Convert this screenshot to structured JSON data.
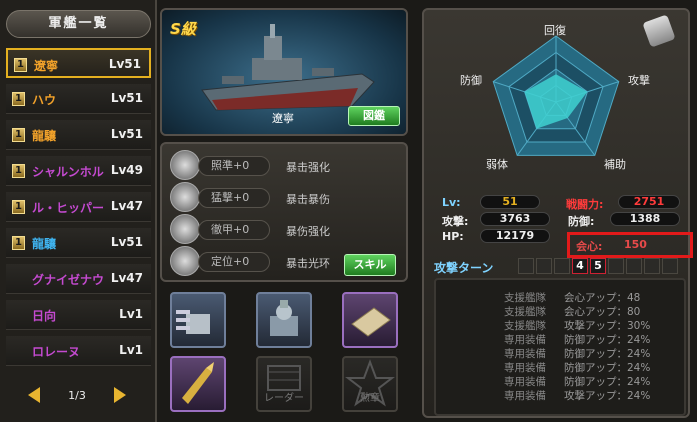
{
  "sidebar": {
    "title": "軍艦一覧",
    "ships": [
      {
        "name": "遼寧",
        "level": "Lv51",
        "badge": "1",
        "color": "#f2a22a",
        "selected": true
      },
      {
        "name": "ハウ",
        "level": "Lv51",
        "badge": "1",
        "color": "#f2a22a",
        "selected": false
      },
      {
        "name": "龍驤",
        "level": "Lv51",
        "badge": "1",
        "color": "#f2a22a",
        "selected": false
      },
      {
        "name": "シャルンホル",
        "level": "Lv49",
        "badge": "1",
        "color": "#c44ad0",
        "selected": false
      },
      {
        "name": "ル・ヒッパー",
        "level": "Lv47",
        "badge": "1",
        "color": "#c44ad0",
        "selected": false
      },
      {
        "name": "龍驤",
        "level": "Lv51",
        "badge": "1",
        "color": "#3fb4f0",
        "selected": false
      },
      {
        "name": "グナイゼナウ",
        "level": "Lv47",
        "badge": "",
        "color": "#c44ad0",
        "selected": false
      },
      {
        "name": "日向",
        "level": "Lv1",
        "badge": "",
        "color": "#c44ad0",
        "selected": false
      },
      {
        "name": "ロレーヌ",
        "level": "Lv1",
        "badge": "",
        "color": "#c44ad0",
        "selected": false
      }
    ],
    "page": "1/3"
  },
  "ship": {
    "grade": "S級",
    "name": "遼寧",
    "figure_button": "図鑑"
  },
  "skills": [
    {
      "name": "照準+0",
      "desc": "暴击强化"
    },
    {
      "name": "猛撃+0",
      "desc": "暴击暴伤"
    },
    {
      "name": "徹甲+0",
      "desc": "暴伤强化"
    },
    {
      "name": "定位+0",
      "desc": "暴击光环"
    }
  ],
  "skill_button": "スキル",
  "equipment": {
    "slot_radar": "レーダー",
    "slot_medal": "勲章"
  },
  "radar": {
    "axes": [
      "回復",
      "攻撃",
      "補助",
      "弱体",
      "防御"
    ],
    "values": [
      0.42,
      0.5,
      0.3,
      0.5,
      0.5
    ]
  },
  "stats": {
    "lv_label": "Lv:",
    "lv": "51",
    "power_label": "戦闘力:",
    "power": "2751",
    "atk_label": "攻撃:",
    "atk": "3763",
    "def_label": "防御:",
    "def": "1388",
    "hp_label": "HP:",
    "hp": "12179",
    "crit_label": "会心:",
    "crit": "150"
  },
  "turn": {
    "label": "攻撃ターン",
    "active": [
      "4",
      "5"
    ]
  },
  "bonuses": [
    {
      "source": "支援艦隊",
      "effect": "会心アップ：48"
    },
    {
      "source": "支援艦隊",
      "effect": "会心アップ：80"
    },
    {
      "source": "支援艦隊",
      "effect": "攻撃アップ：30%"
    },
    {
      "source": "専用装備",
      "effect": "防御アップ：24%"
    },
    {
      "source": "専用装備",
      "effect": "防御アップ：24%"
    },
    {
      "source": "専用装備",
      "effect": "防御アップ：24%"
    },
    {
      "source": "専用装備",
      "effect": "防御アップ：24%"
    },
    {
      "source": "専用装備",
      "effect": "攻撃アップ：24%"
    }
  ],
  "colors": {
    "gold": "#e4b020",
    "crit_highlight": "#e21a1a",
    "power": "#ff3b3b",
    "radar_fill": "#3fd1d1"
  }
}
